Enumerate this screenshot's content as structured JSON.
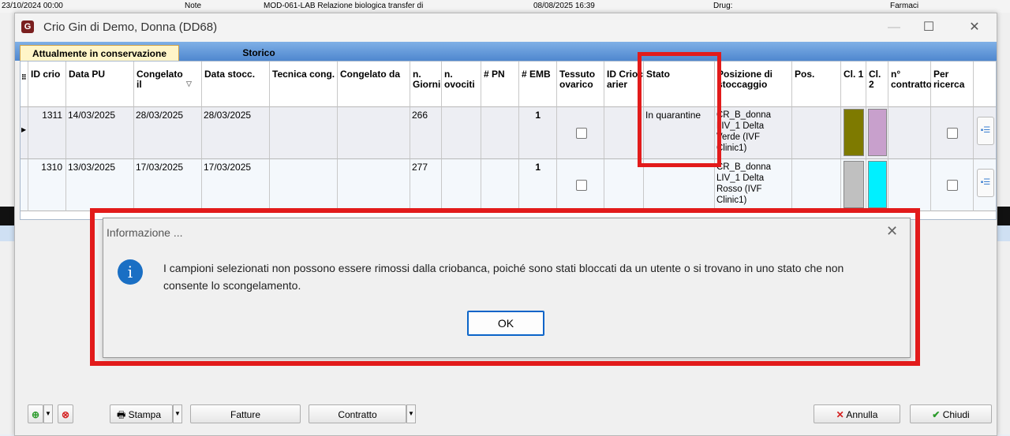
{
  "background": {
    "date": "23/10/2024 00:00",
    "note_label": "Note",
    "doc_label": "MOD-061-LAB Relazione biologica transfer di",
    "datetime": "08/08/2025 16:39",
    "drug_label": "Drug:",
    "farmaci_label": "Farmaci"
  },
  "window": {
    "title": "Crio Gin di Demo, Donna (DD68)",
    "tabs": [
      "Attualmente in conservazione",
      "Storico"
    ]
  },
  "grid": {
    "columns": [
      "ID crio",
      "Data PU",
      "Congelato il",
      "Data stocc.",
      "Tecnica cong.",
      "Congelato da",
      "n. Giorni",
      "n. ovociti",
      "# PN",
      "# EMB",
      "Tessuto ovarico",
      "ID Criocarier",
      "Stato",
      "Posizione di stoccaggio",
      "Pos.",
      "Cl. 1",
      "Cl. 2",
      "n° contratto",
      "Per ricerca"
    ],
    "rows": [
      {
        "id_crio": "1311",
        "data_pu": "14/03/2025",
        "congelato_il": "28/03/2025",
        "data_stocc": "28/03/2025",
        "n_giorni": "266",
        "emb": "1",
        "stato": "In quarantine",
        "posizione": "CR_B_donna LIV_1 Delta Verde (IVF Clinic1)",
        "cl1_color": "#7e7a00",
        "cl2_color": "#c8a0cc"
      },
      {
        "id_crio": "1310",
        "data_pu": "13/03/2025",
        "congelato_il": "17/03/2025",
        "data_stocc": "17/03/2025",
        "n_giorni": "277",
        "emb": "1",
        "stato": "",
        "posizione": "CR_B_donna LIV_1 Delta Rosso (IVF Clinic1)",
        "cl1_color": "#c0c0c0",
        "cl2_color": "#00f0ff"
      }
    ]
  },
  "dialog": {
    "title": "Informazione ...",
    "message": "I campioni selezionati non possono essere rimossi dalla criobanca, poiché sono stati bloccati da un utente o si trovano in uno stato che non consente lo scongelamento.",
    "ok_label": "OK"
  },
  "toolbar": {
    "stampa_label": "Stampa",
    "fatture_label": "Fatture",
    "contratto_label": "Contratto",
    "annulla_label": "Annulla",
    "chiudi_label": "Chiudi"
  },
  "colors": {
    "highlight": "#e21b1b",
    "tab_active_bg": "#fff5c8",
    "tabbar_blue": "#5a90d4",
    "info_blue": "#1a6fc4"
  }
}
